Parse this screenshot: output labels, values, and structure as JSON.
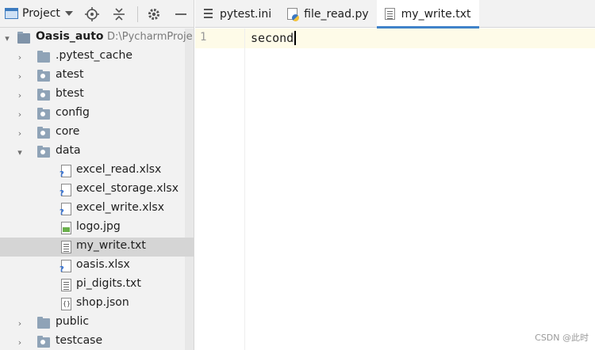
{
  "project_panel": {
    "title": "Project",
    "root": {
      "name": "Oasis_auto",
      "path": "D:\\PycharmProje"
    },
    "items": [
      {
        "name": ".pytest_cache",
        "kind": "folder",
        "expanded": false
      },
      {
        "name": "atest",
        "kind": "folder",
        "expanded": false
      },
      {
        "name": "btest",
        "kind": "folder",
        "expanded": false
      },
      {
        "name": "config",
        "kind": "folder",
        "expanded": false
      },
      {
        "name": "core",
        "kind": "folder",
        "expanded": false
      },
      {
        "name": "data",
        "kind": "folder",
        "expanded": true
      },
      {
        "name": "excel_read.xlsx",
        "kind": "unknown-file"
      },
      {
        "name": "excel_storage.xlsx",
        "kind": "unknown-file"
      },
      {
        "name": "excel_write.xlsx",
        "kind": "unknown-file"
      },
      {
        "name": "logo.jpg",
        "kind": "image-file"
      },
      {
        "name": "my_write.txt",
        "kind": "text-file",
        "selected": true
      },
      {
        "name": "oasis.xlsx",
        "kind": "unknown-file"
      },
      {
        "name": "pi_digits.txt",
        "kind": "text-file"
      },
      {
        "name": "shop.json",
        "kind": "json-file"
      },
      {
        "name": "public",
        "kind": "folder",
        "expanded": false
      },
      {
        "name": "testcase",
        "kind": "folder",
        "expanded": false
      }
    ]
  },
  "editor": {
    "tabs": [
      {
        "label": "pytest.ini",
        "icon": "ini-file-icon",
        "active": false
      },
      {
        "label": "file_read.py",
        "icon": "python-file-icon",
        "active": false
      },
      {
        "label": "my_write.txt",
        "icon": "text-file-icon",
        "active": true
      }
    ],
    "line_number": "1",
    "content": "second"
  },
  "watermark": "CSDN @此时",
  "colors": {
    "accent": "#4083c9",
    "panel_bg": "#f2f2f2",
    "selection_bg": "#d5d5d5",
    "current_line_bg": "#fefbe8"
  }
}
